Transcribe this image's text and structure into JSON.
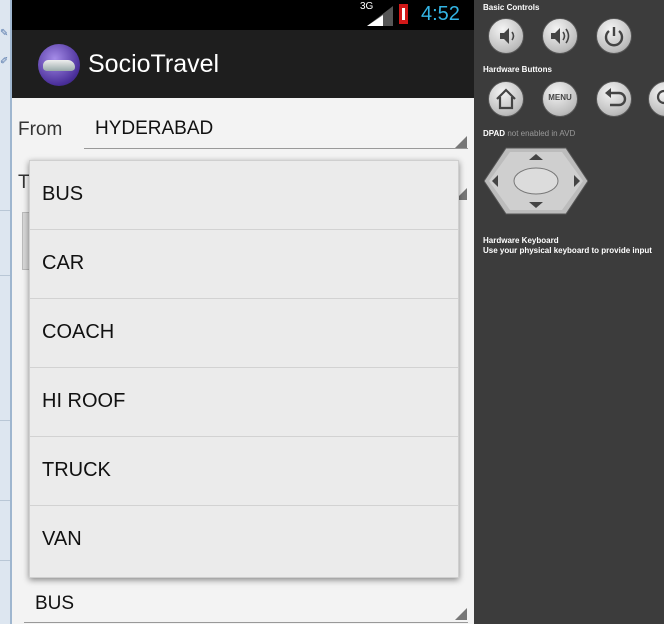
{
  "status_bar": {
    "network": "3G",
    "time": "4:52"
  },
  "app": {
    "title": "SocioTravel"
  },
  "form": {
    "from_label": "From",
    "from_value": "HYDERABAD",
    "to_label": "T",
    "vehicle_value": "BUS"
  },
  "dropdown": {
    "items": [
      "BUS",
      "CAR",
      "COACH",
      "HI ROOF",
      "TRUCK",
      "VAN"
    ]
  },
  "emulator": {
    "basic_controls_title": "Basic Controls",
    "hardware_buttons_title": "Hardware Buttons",
    "menu_label": "MENU",
    "dpad_title": "DPAD",
    "dpad_note": "not enabled in AVD",
    "keyboard_title": "Hardware Keyboard",
    "keyboard_note": "Use your physical keyboard to provide input"
  },
  "colors": {
    "clock": "#33b5e5",
    "action_bar": "#1e1e1e",
    "battery": "#d01818"
  }
}
